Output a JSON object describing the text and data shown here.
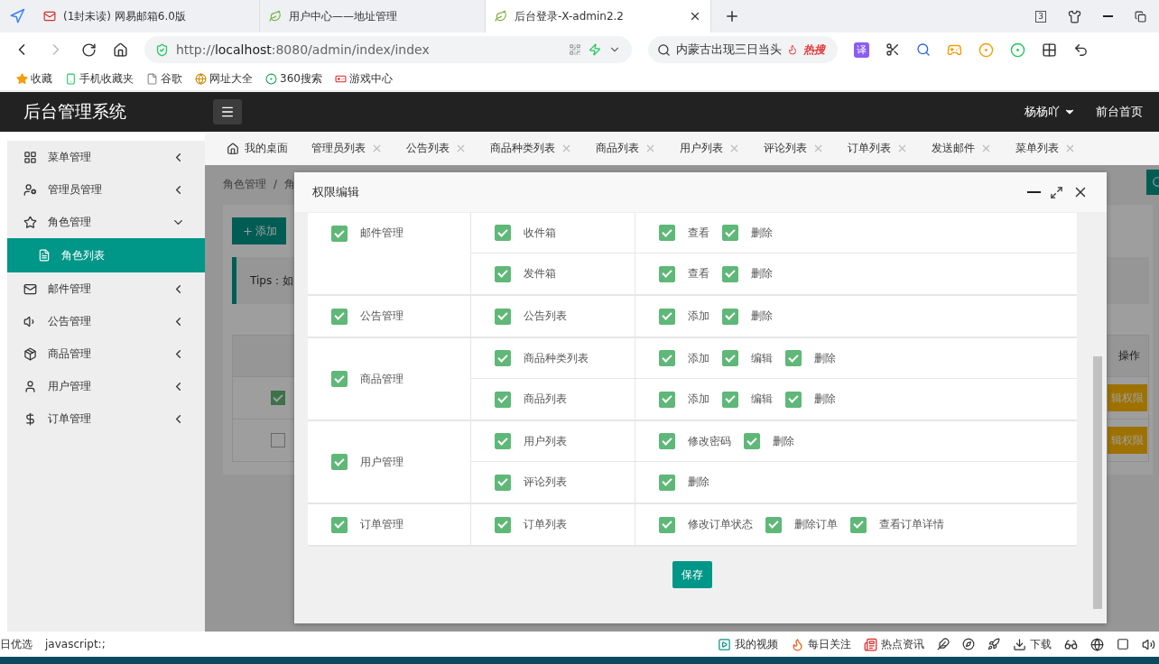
{
  "browser": {
    "tabs": [
      {
        "title": "(1封未读) 网易邮箱6.0版",
        "selected": false
      },
      {
        "title": "用户中心——地址管理",
        "selected": false
      },
      {
        "title": "后台登录-X-admin2.2",
        "selected": true
      }
    ],
    "window_count": "3",
    "url_prefix": "http://",
    "url_host": "localhost",
    "url_rest": ":8080/admin/index/index",
    "search": "内蒙古出现三日当头",
    "search_badge": "热搜",
    "translate": "译",
    "bookmarks": [
      "收藏",
      "手机收藏夹",
      "谷歌",
      "网址大全",
      "360搜索",
      "游戏中心"
    ]
  },
  "app": {
    "title": "后台管理系统",
    "user": "杨杨吖",
    "front_link": "前台首页",
    "sidebar": [
      {
        "label": "菜单管理",
        "expanded": false
      },
      {
        "label": "管理员管理",
        "expanded": false
      },
      {
        "label": "角色管理",
        "expanded": true,
        "children": [
          {
            "label": "角色列表",
            "selected": true
          }
        ]
      },
      {
        "label": "邮件管理",
        "expanded": false
      },
      {
        "label": "公告管理",
        "expanded": false
      },
      {
        "label": "商品管理",
        "expanded": false
      },
      {
        "label": "用户管理",
        "expanded": false
      },
      {
        "label": "订单管理",
        "expanded": false
      }
    ],
    "tabs": [
      {
        "label": "我的桌面",
        "kind": "home"
      },
      {
        "label": "管理员列表",
        "kind": "closable"
      },
      {
        "label": "公告列表",
        "kind": "closable"
      },
      {
        "label": "商品种类列表",
        "kind": "closable"
      },
      {
        "label": "商品列表",
        "kind": "closable"
      },
      {
        "label": "用户列表",
        "kind": "closable"
      },
      {
        "label": "评论列表",
        "kind": "closable"
      },
      {
        "label": "订单列表",
        "kind": "closable"
      },
      {
        "label": "发送邮件",
        "kind": "closable"
      },
      {
        "label": "菜单列表",
        "kind": "closable"
      }
    ],
    "breadcrumb": [
      "角色管理",
      "角"
    ],
    "breadcrumb_separator": "/",
    "add_button": "添加",
    "tips": "Tips：如",
    "table_header": "操作",
    "rows": [
      {
        "checked": true,
        "action": "辑权限"
      },
      {
        "checked": false,
        "action": "辑权限"
      }
    ]
  },
  "modal": {
    "title": "权限编辑",
    "save": "保存",
    "groups": [
      {
        "label": "邮件管理",
        "checked": true,
        "subs": [
          {
            "label": "收件箱",
            "checked": true,
            "perms": [
              {
                "label": "查看",
                "checked": true
              },
              {
                "label": "删除",
                "checked": true
              }
            ]
          },
          {
            "label": "发件箱",
            "checked": true,
            "perms": [
              {
                "label": "查看",
                "checked": true
              },
              {
                "label": "删除",
                "checked": true
              }
            ]
          }
        ]
      },
      {
        "label": "公告管理",
        "checked": true,
        "subs": [
          {
            "label": "公告列表",
            "checked": true,
            "perms": [
              {
                "label": "添加",
                "checked": true
              },
              {
                "label": "删除",
                "checked": true
              }
            ]
          }
        ]
      },
      {
        "label": "商品管理",
        "checked": true,
        "subs": [
          {
            "label": "商品种类列表",
            "checked": true,
            "perms": [
              {
                "label": "添加",
                "checked": true
              },
              {
                "label": "编辑",
                "checked": true
              },
              {
                "label": "删除",
                "checked": true
              }
            ]
          },
          {
            "label": "商品列表",
            "checked": true,
            "perms": [
              {
                "label": "添加",
                "checked": true
              },
              {
                "label": "编辑",
                "checked": true
              },
              {
                "label": "删除",
                "checked": true
              }
            ]
          }
        ]
      },
      {
        "label": "用户管理",
        "checked": true,
        "subs": [
          {
            "label": "用户列表",
            "checked": true,
            "perms": [
              {
                "label": "修改密码",
                "checked": true
              },
              {
                "label": "删除",
                "checked": true
              }
            ]
          },
          {
            "label": "评论列表",
            "checked": true,
            "perms": [
              {
                "label": "删除",
                "checked": true
              }
            ]
          }
        ]
      },
      {
        "label": "订单管理",
        "checked": true,
        "subs": [
          {
            "label": "订单列表",
            "checked": true,
            "perms": [
              {
                "label": "修改订单状态",
                "checked": true
              },
              {
                "label": "删除订单",
                "checked": true
              },
              {
                "label": "查看订单详情",
                "checked": true
              }
            ]
          }
        ]
      }
    ]
  },
  "status": {
    "left": [
      "日优选",
      "javascript:;"
    ],
    "right": [
      "我的视频",
      "每日关注",
      "热点资讯",
      "下载"
    ]
  }
}
